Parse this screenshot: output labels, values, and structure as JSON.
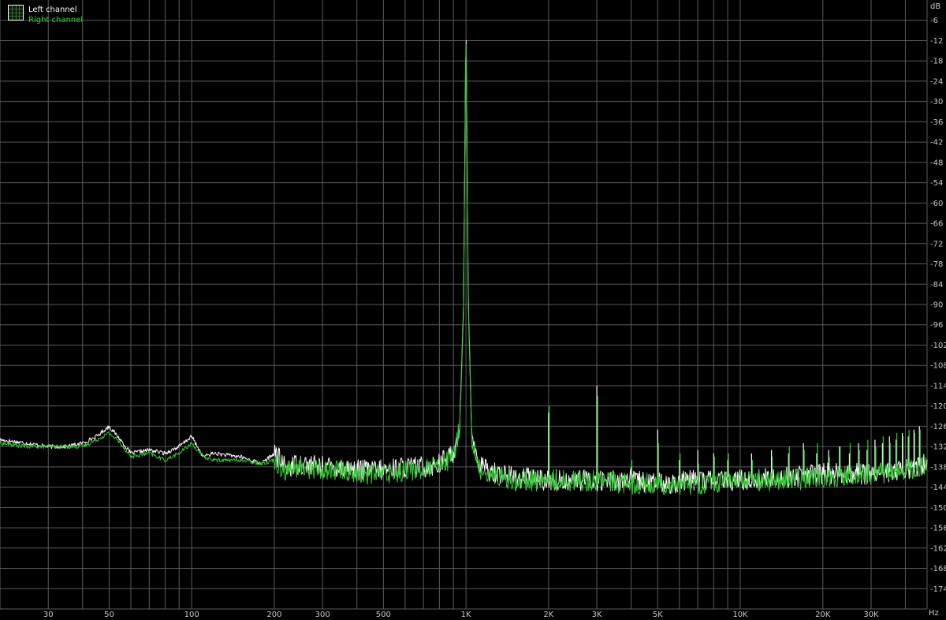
{
  "chart_data": {
    "type": "line",
    "x_scale": "log",
    "xlim": [
      20,
      48000
    ],
    "ylim": [
      -180,
      0
    ],
    "y_unit": "dB",
    "x_unit": "Hz",
    "grid": true,
    "legend_position": "top-left",
    "y_ticks": [
      -6,
      -12,
      -18,
      -24,
      -30,
      -36,
      -42,
      -48,
      -54,
      -60,
      -66,
      -72,
      -78,
      -84,
      -90,
      -96,
      -102,
      -108,
      -114,
      -120,
      -126,
      -132,
      -138,
      -144,
      -150,
      -156,
      -162,
      -168,
      -174
    ],
    "x_tick_labels": [
      {
        "value": 30,
        "label": "30"
      },
      {
        "value": 50,
        "label": "50"
      },
      {
        "value": 100,
        "label": "100"
      },
      {
        "value": 200,
        "label": "200"
      },
      {
        "value": 300,
        "label": "300"
      },
      {
        "value": 500,
        "label": "500"
      },
      {
        "value": 1000,
        "label": "1K"
      },
      {
        "value": 2000,
        "label": "2K"
      },
      {
        "value": 3000,
        "label": "3K"
      },
      {
        "value": 5000,
        "label": "5K"
      },
      {
        "value": 10000,
        "label": "10K"
      },
      {
        "value": 20000,
        "label": "20K"
      },
      {
        "value": 30000,
        "label": "30K"
      }
    ],
    "series": [
      {
        "name": "Left channel",
        "color": "#ffffff",
        "x": [
          20,
          25,
          30,
          35,
          40,
          45,
          50,
          55,
          60,
          70,
          80,
          90,
          100,
          110,
          120,
          150,
          180,
          200,
          220,
          250,
          300,
          350,
          400,
          500,
          600,
          700,
          800,
          900,
          950,
          980,
          1000,
          1020,
          1050,
          1100,
          1200,
          1500,
          2000,
          2500,
          3000,
          4000,
          5000,
          7000,
          10000,
          15000,
          20000,
          30000,
          40000,
          48000
        ],
        "y": [
          -130,
          -131,
          -132,
          -132,
          -131,
          -129,
          -126,
          -130,
          -134,
          -133,
          -134,
          -132,
          -129,
          -135,
          -134,
          -135,
          -137,
          -134,
          -138,
          -137,
          -138,
          -138,
          -139,
          -139,
          -138,
          -138,
          -137,
          -134,
          -125,
          -90,
          -4,
          -90,
          -128,
          -137,
          -139,
          -141,
          -142,
          -142,
          -142,
          -142,
          -143,
          -142,
          -142,
          -141,
          -140,
          -140,
          -139,
          -137
        ]
      },
      {
        "name": "Right channel",
        "color": "#33cc33",
        "x": [
          20,
          25,
          30,
          35,
          40,
          45,
          50,
          55,
          60,
          70,
          80,
          90,
          100,
          110,
          120,
          150,
          180,
          200,
          220,
          250,
          300,
          350,
          400,
          500,
          600,
          700,
          800,
          900,
          950,
          980,
          1000,
          1020,
          1050,
          1100,
          1200,
          1500,
          2000,
          2500,
          3000,
          4000,
          5000,
          7000,
          10000,
          15000,
          20000,
          30000,
          40000,
          48000
        ],
        "y": [
          -131,
          -132,
          -132,
          -132,
          -132,
          -130,
          -128,
          -131,
          -135,
          -134,
          -136,
          -134,
          -131,
          -135,
          -136,
          -136,
          -137,
          -136,
          -139,
          -138,
          -139,
          -139,
          -140,
          -140,
          -139,
          -139,
          -138,
          -135,
          -126,
          -92,
          -5,
          -92,
          -129,
          -138,
          -140,
          -142,
          -142,
          -142,
          -142,
          -143,
          -143,
          -143,
          -142,
          -142,
          -141,
          -140,
          -139,
          -138
        ]
      }
    ],
    "harmonic_spikes": [
      {
        "x": 2000,
        "y_left": -122,
        "y_right": -120
      },
      {
        "x": 3000,
        "y_left": -114,
        "y_right": -117
      },
      {
        "x": 4000,
        "y_left": -138,
        "y_right": -136
      },
      {
        "x": 5000,
        "y_left": -127,
        "y_right": -131
      },
      {
        "x": 6000,
        "y_left": -136,
        "y_right": -134
      },
      {
        "x": 7000,
        "y_left": -133,
        "y_right": -137
      },
      {
        "x": 8000,
        "y_left": -134,
        "y_right": -135
      },
      {
        "x": 9000,
        "y_left": -136,
        "y_right": -134
      },
      {
        "x": 11000,
        "y_left": -134,
        "y_right": -136
      },
      {
        "x": 13000,
        "y_left": -133,
        "y_right": -135
      },
      {
        "x": 15000,
        "y_left": -134,
        "y_right": -132
      },
      {
        "x": 17000,
        "y_left": -131,
        "y_right": -133
      },
      {
        "x": 19000,
        "y_left": -134,
        "y_right": -131
      },
      {
        "x": 21000,
        "y_left": -133,
        "y_right": -135
      },
      {
        "x": 23000,
        "y_left": -132,
        "y_right": -132
      },
      {
        "x": 25000,
        "y_left": -134,
        "y_right": -131
      },
      {
        "x": 27000,
        "y_left": -131,
        "y_right": -133
      },
      {
        "x": 29000,
        "y_left": -133,
        "y_right": -130
      },
      {
        "x": 31000,
        "y_left": -130,
        "y_right": -132
      },
      {
        "x": 33000,
        "y_left": -131,
        "y_right": -129
      },
      {
        "x": 35000,
        "y_left": -129,
        "y_right": -131
      },
      {
        "x": 37000,
        "y_left": -130,
        "y_right": -128
      },
      {
        "x": 39000,
        "y_left": -128,
        "y_right": -129
      },
      {
        "x": 41000,
        "y_left": -129,
        "y_right": -127
      },
      {
        "x": 43000,
        "y_left": -127,
        "y_right": -128
      },
      {
        "x": 45000,
        "y_left": -126,
        "y_right": -127
      }
    ]
  },
  "axis_labels": {
    "y_unit_label": "dB",
    "x_unit_label": "Hz"
  },
  "legend": {
    "left_label": "Left channel",
    "right_label": "Right channel"
  },
  "colors": {
    "background": "#000000",
    "grid": "#5a5a5a",
    "left": "#ffffff",
    "right": "#33cc33",
    "text": "#c8c8c8"
  }
}
